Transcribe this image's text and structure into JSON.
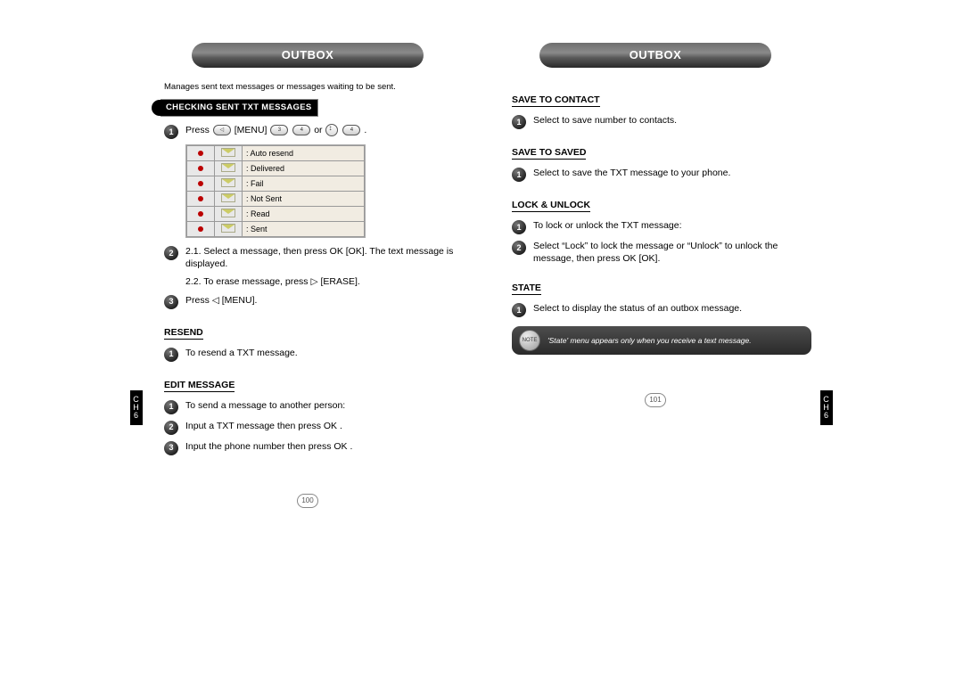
{
  "spread": {
    "chapter_label": "CH\n6",
    "left": {
      "title": "OUTBOX",
      "intro": "Manages sent text messages or messages waiting to be sent.",
      "section_header": "CHECKING SENT TXT MESSAGES",
      "steps_main": [
        {
          "n": "1",
          "pre": "Press ",
          "key1": "[MENU]",
          "mid": " ",
          "btns": "3  4",
          "alt": " or",
          "btns2": "4",
          "suffix": " ."
        },
        {
          "n": "2",
          "lines": [
            "2.1. Select a message, then press  OK  [OK]. The text message is displayed.",
            "2.2. To erase message, press  ▷  [ERASE]."
          ]
        },
        {
          "n": "3",
          "text": "Press  ◁  [MENU]."
        }
      ],
      "phone_screenshot": {
        "rows": [
          {
            "label": ": Auto resend"
          },
          {
            "label": ": Delivered"
          },
          {
            "label": ": Fail"
          },
          {
            "label": ": Not Sent"
          },
          {
            "label": ": Read"
          },
          {
            "label": ": Sent"
          }
        ]
      },
      "subsections": [
        {
          "head": "RESEND",
          "steps": [
            {
              "n": "1",
              "text": "To resend a TXT message."
            }
          ]
        },
        {
          "head": "EDIT MESSAGE",
          "steps": [
            {
              "n": "1",
              "text": "To send a message to another person:"
            },
            {
              "n": "2",
              "text": "Input a TXT message then press  OK  ."
            },
            {
              "n": "3",
              "text": "Input the phone number then press  OK  ."
            }
          ]
        }
      ],
      "pageno": "100"
    },
    "right": {
      "title": "OUTBOX",
      "subsections": [
        {
          "head": "SAVE TO CONTACT",
          "steps": [
            {
              "n": "1",
              "text": "Select to save number to contacts."
            }
          ]
        },
        {
          "head": "SAVE TO SAVED",
          "steps": [
            {
              "n": "1",
              "text": "Select to save the TXT message to your phone."
            }
          ]
        },
        {
          "head": "LOCK & UNLOCK",
          "steps": [
            {
              "n": "1",
              "text": "To lock or unlock the TXT message:"
            },
            {
              "n": "2",
              "text": "Select “Lock” to lock the message or “Unlock” to unlock the message, then press  OK  [OK]."
            }
          ]
        },
        {
          "head": "STATE",
          "steps": [
            {
              "n": "1",
              "text": "Select to display the status of an outbox message."
            }
          ]
        }
      ],
      "note": "'State' menu appears only when you receive a text message.",
      "pageno": "101"
    }
  }
}
